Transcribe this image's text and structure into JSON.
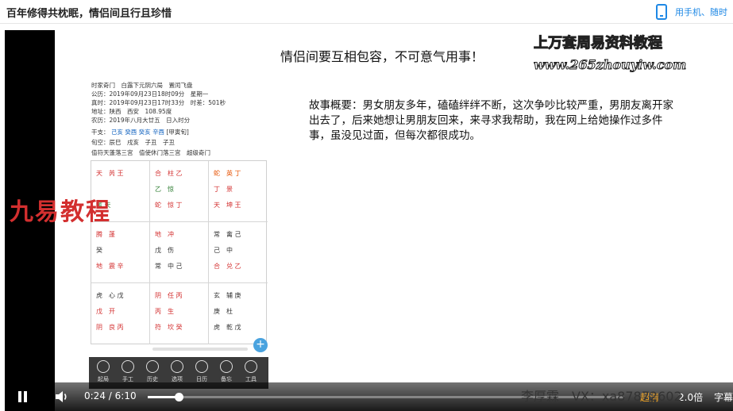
{
  "page": {
    "title": "百年修得共枕眠，情侣间且行且珍惜",
    "phone_link": "用手机、随时"
  },
  "video": {
    "headline": "情侣间要互相包容，不可意气用事！",
    "watermark_right_1": "上万套周易资料教程",
    "watermark_right_2": "www.265zhouyiw.com",
    "watermark_left": "九易教程",
    "story": "故事概要：男女朋友多年，磕磕绊绊不断，这次争吵比较严重，男朋友离开家出去了，后来她想让男朋友回来，来寻求我帮助，我在网上给她操作过多件事，虽没见过面，但每次都很成功。",
    "bottom_watermark": "李厚霖　VX：xa87872602",
    "phone": {
      "header_lines": [
        "时家奇门　白露下元阴六局　置闰飞盘",
        "公历：2019年09月23日18时09分　星期一",
        "真时：2019年09月23日17时33分　时差：501秒",
        "地址：陕西　西安　108.95度",
        "农历：2019年八月大廿五　日入时分"
      ],
      "ganzhi_label": "干支：",
      "ganzhi": [
        "己亥",
        "癸酉",
        "癸亥",
        "辛酉"
      ],
      "ganzhi_note": "[甲寅旬]",
      "xunkong": "旬空：辰巳　戌亥　子丑　子丑",
      "zhifu": "值符天蓬落三宫　值使休门落三宫　超级奇门",
      "cells": [
        [
          "天　芮 王",
          "",
          "禽 天"
        ],
        [
          "合　柱 乙",
          "乙　惊",
          "蛇　惊 丁"
        ],
        [
          "蛇　英 丁",
          "丁　景",
          "天　坤 王"
        ],
        [
          "腾　蓬",
          "癸",
          "地　震 辛"
        ],
        [
          "地　冲",
          "戊　伤",
          "常　中 己"
        ],
        [
          "常　禽 己",
          "己　中",
          "合　兑 乙"
        ],
        [
          "虎　心 戊",
          "戊　开",
          "阴　良 丙"
        ],
        [
          "阴　任 丙",
          "丙　生",
          "符　坎 癸"
        ],
        [
          "玄　辅 庚",
          "庚　杜",
          "虎　乾 戊"
        ]
      ],
      "toolbar": [
        "起局",
        "手工",
        "历史",
        "选项",
        "日历",
        "备忘",
        "工具"
      ]
    },
    "controls": {
      "current_time": "0:24",
      "separator": "/",
      "duration": "6:10",
      "progress_fraction": 0.065,
      "quality_label": "超清",
      "speed_label": "2.0倍",
      "subtitle_label": "字幕"
    }
  }
}
